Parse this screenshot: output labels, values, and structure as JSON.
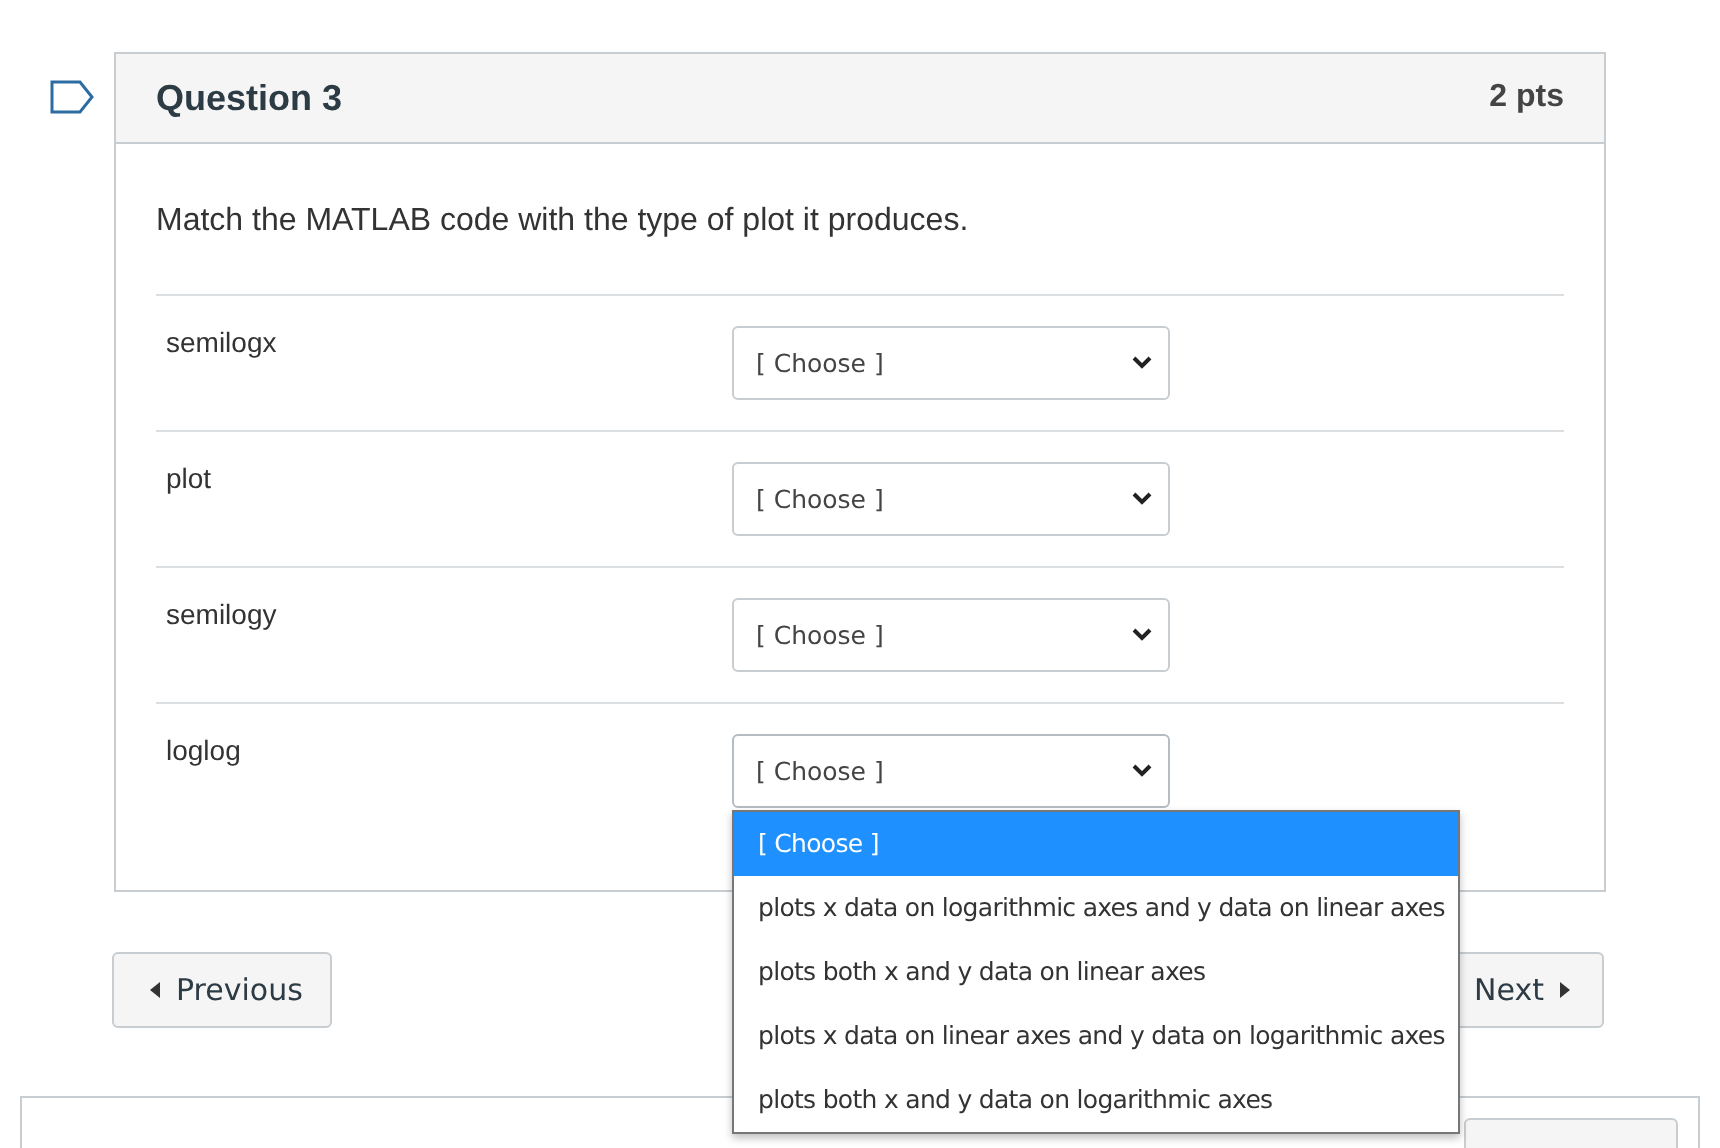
{
  "question": {
    "title": "Question 3",
    "points": "2 pts",
    "prompt": "Match the MATLAB code with the type of plot it produces.",
    "rows": [
      {
        "label": "semilogx",
        "value": "[ Choose ]",
        "open": false
      },
      {
        "label": "plot",
        "value": "[ Choose ]",
        "open": false
      },
      {
        "label": "semilogy",
        "value": "[ Choose ]",
        "open": false
      },
      {
        "label": "loglog",
        "value": "[ Choose ]",
        "open": true
      }
    ],
    "options": [
      {
        "label": "[ Choose ]",
        "selected": true
      },
      {
        "label": "plots x data on logarithmic axes and y data on linear axes",
        "selected": false
      },
      {
        "label": "plots both x and y data on linear axes",
        "selected": false
      },
      {
        "label": "plots x data on linear axes and y data on logarithmic axes",
        "selected": false
      },
      {
        "label": "plots both x and y data on logarithmic axes",
        "selected": false
      }
    ]
  },
  "navigation": {
    "previous": "Previous",
    "next": "Next"
  }
}
